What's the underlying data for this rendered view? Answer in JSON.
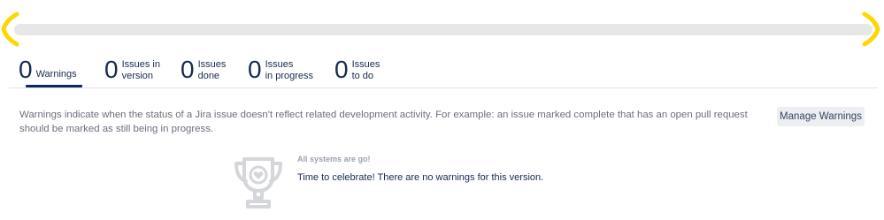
{
  "progress": {
    "fill_fraction": 0.0,
    "track_color": "#e7e7e7",
    "bracket_color": "#ffd700"
  },
  "tabs": [
    {
      "count": "0",
      "label": "Warnings",
      "active": true
    },
    {
      "count": "0",
      "label": "Issues in\nversion",
      "active": false
    },
    {
      "count": "0",
      "label": "Issues\ndone",
      "active": false
    },
    {
      "count": "0",
      "label": "Issues\nin progress",
      "active": false
    },
    {
      "count": "0",
      "label": "Issues\nto do",
      "active": false
    }
  ],
  "description": "Warnings indicate when the status of a Jira issue doesn't reflect related development activity. For example: an issue marked complete that has an open pull request should be marked as still being in progress.",
  "manage_button": "Manage Warnings",
  "empty_state": {
    "icon": "trophy-icon",
    "title": "All systems are go!",
    "message": "Time to celebrate! There are no warnings for this version."
  },
  "colors": {
    "active_underline": "#0a2a5e",
    "text_primary": "#172b4d",
    "text_secondary": "#6b6f7b"
  }
}
